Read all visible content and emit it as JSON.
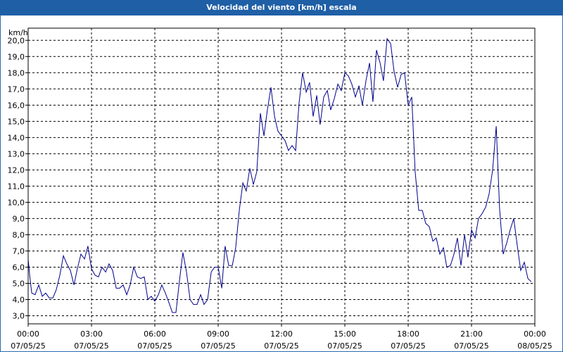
{
  "chart_data": {
    "type": "line",
    "title": "Velocidad del viento [km/h] escala",
    "ylabel": "km/h",
    "ylim": [
      2.5,
      20.75
    ],
    "yticks": [
      "3,0",
      "4,0",
      "5,0",
      "6,0",
      "7,0",
      "8,0",
      "9,0",
      "10,0",
      "11,0",
      "12,0",
      "13,0",
      "14,0",
      "15,0",
      "16,0",
      "17,0",
      "18,0",
      "19,0",
      "20,0"
    ],
    "xticks": [
      {
        "time": "00:00",
        "date": "07/05/25"
      },
      {
        "time": "03:00",
        "date": "07/05/25"
      },
      {
        "time": "06:00",
        "date": "07/05/25"
      },
      {
        "time": "09:00",
        "date": "07/05/25"
      },
      {
        "time": "12:00",
        "date": "07/05/25"
      },
      {
        "time": "15:00",
        "date": "07/05/25"
      },
      {
        "time": "18:00",
        "date": "07/05/25"
      },
      {
        "time": "21:00",
        "date": "07/05/25"
      },
      {
        "time": "00:00",
        "date": "08/05/25"
      }
    ],
    "xlim_hours": [
      0,
      24
    ],
    "grid": true,
    "line_color": "#00008b",
    "series": [
      {
        "x_hours": [
          0,
          0.08,
          0.17,
          0.33,
          0.5,
          0.67,
          0.83,
          1,
          1.17,
          1.33,
          1.5,
          1.67,
          1.83,
          2,
          2.17,
          2.33,
          2.5,
          2.67,
          2.83,
          3,
          3.17,
          3.33,
          3.5,
          3.67,
          3.83,
          4,
          4.17,
          4.33,
          4.5,
          4.67,
          4.83,
          5,
          5.17,
          5.33,
          5.5,
          5.67,
          5.83,
          6,
          6.17,
          6.33,
          6.5,
          6.67,
          6.83,
          7,
          7.17,
          7.33,
          7.5,
          7.67,
          7.83,
          8,
          8.17,
          8.33,
          8.5,
          8.67,
          8.83,
          9,
          9.17,
          9.33,
          9.5,
          9.67,
          9.83,
          10,
          10.17,
          10.33,
          10.5,
          10.67,
          10.83,
          11,
          11.17,
          11.33,
          11.5,
          11.67,
          11.83,
          12,
          12.17,
          12.33,
          12.5,
          12.67,
          12.83,
          13,
          13.17,
          13.33,
          13.5,
          13.67,
          13.83,
          14,
          14.17,
          14.33,
          14.5,
          14.67,
          14.83,
          15,
          15.17,
          15.33,
          15.5,
          15.67,
          15.83,
          16,
          16.17,
          16.33,
          16.5,
          16.67,
          16.83,
          17,
          17.17,
          17.33,
          17.5,
          17.67,
          17.83,
          18,
          18.17,
          18.33,
          18.5,
          18.67,
          18.83,
          19,
          19.17,
          19.33,
          19.5,
          19.67,
          19.83,
          20,
          20.17,
          20.33,
          20.5,
          20.67,
          20.83,
          21,
          21.17,
          21.33,
          21.5,
          21.67,
          21.83,
          22,
          22.17,
          22.33,
          22.5,
          22.67,
          22.83,
          23,
          23.17,
          23.33,
          23.5,
          23.67,
          23.83
        ],
        "y": [
          6.5,
          5.4,
          4.4,
          4.3,
          4.9,
          4.2,
          4.4,
          4.1,
          4.1,
          4.6,
          5.5,
          6.7,
          6.2,
          5.8,
          4.9,
          5.9,
          6.8,
          6.5,
          7.3,
          5.9,
          5.5,
          5.4,
          6.0,
          5.7,
          6.2,
          5.8,
          4.7,
          4.7,
          4.9,
          4.3,
          4.9,
          6.0,
          5.4,
          5.3,
          5.4,
          4.0,
          4.2,
          3.9,
          4.3,
          4.9,
          4.4,
          3.8,
          3.2,
          3.2,
          5.2,
          6.9,
          5.7,
          4.0,
          3.7,
          3.7,
          4.3,
          3.7,
          4.0,
          5.7,
          6.0,
          6.0,
          4.7,
          7.3,
          6.1,
          6.1,
          7.2,
          9.5,
          11.2,
          10.7,
          12.1,
          11.1,
          11.9,
          15.5,
          14.1,
          15.7,
          17.1,
          15.3,
          14.4,
          14.1,
          13.8,
          13.2,
          13.5,
          13.2,
          16.1,
          18.0,
          16.8,
          17.4,
          15.3,
          16.6,
          14.8,
          16.5,
          16.9,
          15.7,
          16.4,
          17.3,
          16.9,
          18.0,
          17.8,
          17.3,
          16.5,
          17.2,
          16.0,
          17.5,
          18.6,
          16.2,
          19.4,
          18.6,
          17.5,
          20.1,
          19.8,
          18.1,
          17.1,
          17.9,
          18.0,
          16.0,
          16.5,
          11.9,
          9.5,
          9.5,
          8.7,
          8.5,
          7.6,
          7.8,
          6.8,
          7.2,
          6.0,
          6.1,
          6.8,
          7.8,
          6.1,
          8.0,
          6.6,
          8.3,
          7.8,
          9.0,
          9.3,
          9.7,
          10.5,
          12.0,
          14.7,
          9.6,
          6.8,
          7.5,
          8.3,
          9.0,
          7.3,
          5.8,
          6.3,
          5.3,
          5.1
        ]
      }
    ]
  }
}
